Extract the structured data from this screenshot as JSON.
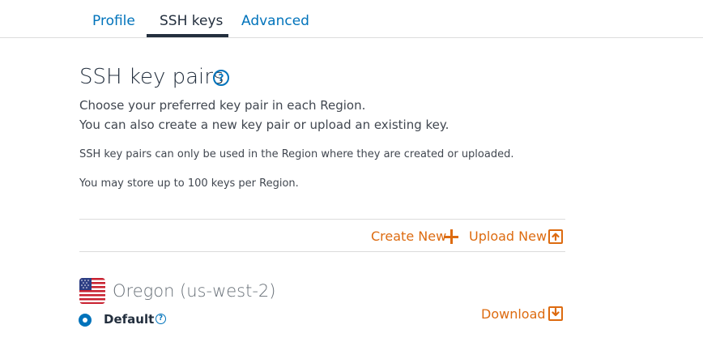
{
  "tabs": [
    {
      "label": "Profile"
    },
    {
      "label": "SSH keys"
    },
    {
      "label": "Advanced"
    }
  ],
  "header": {
    "title": "SSH key pairs",
    "help_glyph": "?"
  },
  "description": {
    "line1": "Choose your preferred key pair in each Region.",
    "line2": "You can also create a new key pair or upload an existing key.",
    "note1": "SSH key pairs can only be used in the Region where they are created or uploaded.",
    "note2": "You may store up to 100 keys per Region."
  },
  "actions": {
    "create_label": "Create New",
    "upload_label": "Upload New",
    "download_label": "Download"
  },
  "region": {
    "name": "Oregon (us-west-2)",
    "flag_icon": "us-flag-icon",
    "default_label": "Default",
    "help_glyph": "?"
  },
  "colors": {
    "link": "#0073bb",
    "action": "#dd6b10",
    "text": "#232f3e"
  }
}
